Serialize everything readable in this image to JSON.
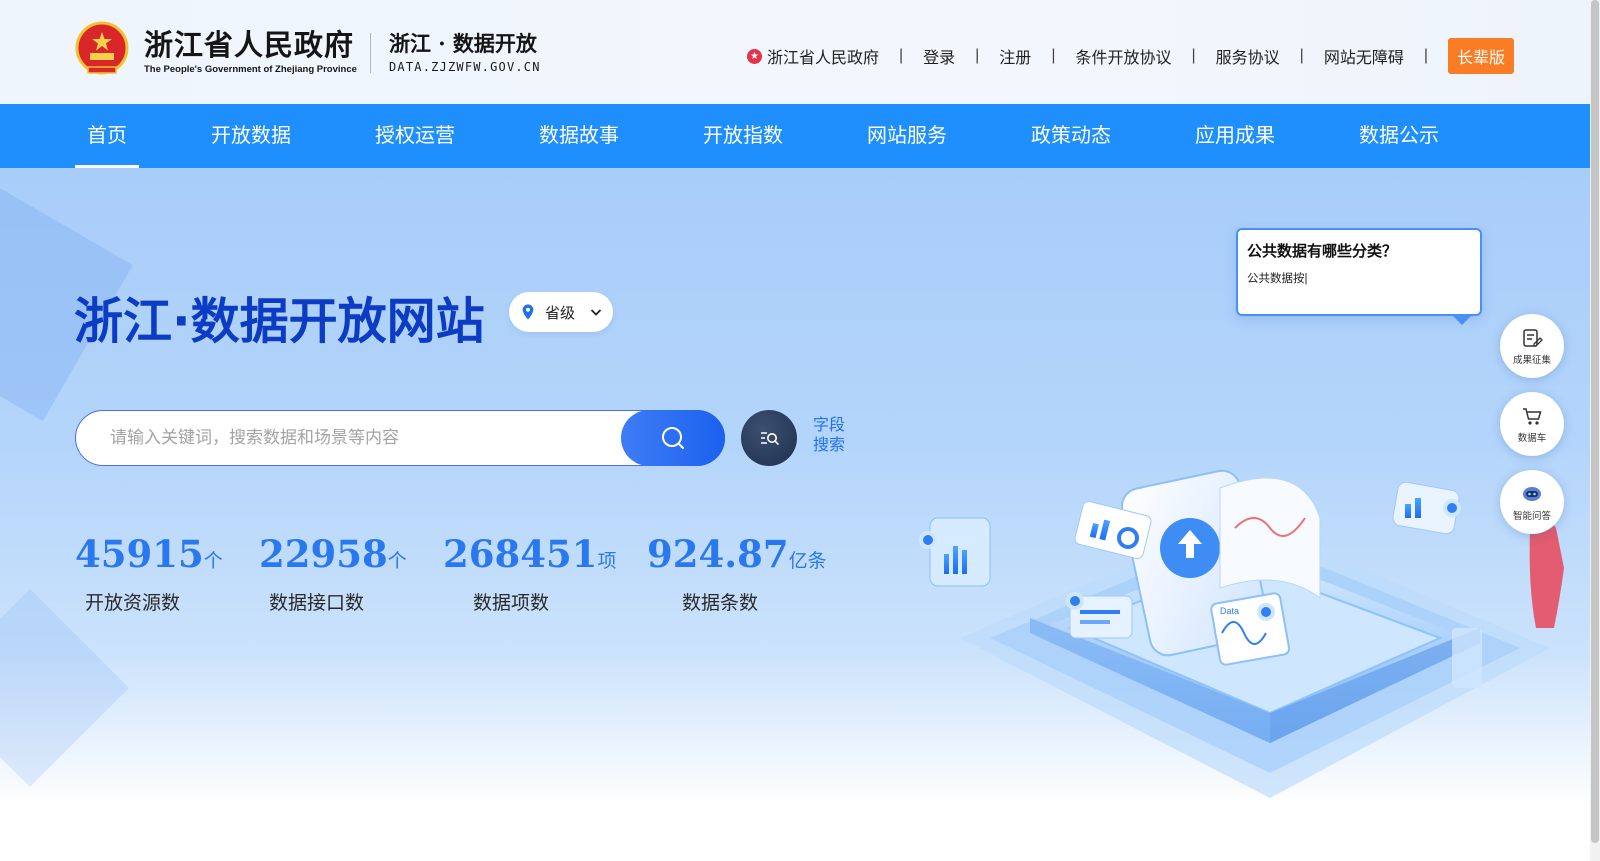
{
  "header": {
    "logo_cn": "浙江省人民政府",
    "logo_en": "The People's Government of Zhejiang Province",
    "site_cn": "浙江 · 数据开放",
    "site_url": "DATA.ZJZWFW.GOV.CN",
    "links": {
      "gov": "浙江省人民政府",
      "login": "登录",
      "register": "注册",
      "conditional_agreement": "条件开放协议",
      "service_agreement": "服务协议",
      "accessibility": "网站无障碍",
      "elder_mode": "长辈版"
    },
    "separator": "|"
  },
  "nav": {
    "items": [
      {
        "label": "首页",
        "active": true
      },
      {
        "label": "开放数据"
      },
      {
        "label": "授权运营"
      },
      {
        "label": "数据故事"
      },
      {
        "label": "开放指数"
      },
      {
        "label": "网站服务"
      },
      {
        "label": "政策动态"
      },
      {
        "label": "应用成果"
      },
      {
        "label": "数据公示"
      }
    ]
  },
  "hero": {
    "title": "浙江·数据开放网站",
    "level_select": {
      "value": "省级"
    },
    "search": {
      "placeholder": "请输入关键词，搜索数据和场景等内容",
      "value": ""
    },
    "field_search": {
      "line1": "字段",
      "line2": "搜索"
    },
    "stats": [
      {
        "value": "45915",
        "unit": "个",
        "label": "开放资源数"
      },
      {
        "value": "22958",
        "unit": "个",
        "label": "数据接口数"
      },
      {
        "value": "268451",
        "unit": "项",
        "label": "数据项数"
      },
      {
        "value": "924.87",
        "unit": "亿条",
        "label": "数据条数"
      }
    ],
    "bubble": {
      "question": "公共数据有哪些分类？",
      "answer": "公共数据按|"
    },
    "illustration_label": "Data"
  },
  "side_tools": [
    {
      "label": "成果征集",
      "icon": "edit-icon"
    },
    {
      "label": "数据车",
      "icon": "cart-icon"
    },
    {
      "label": "智能问答",
      "icon": "robot-icon"
    }
  ],
  "colors": {
    "nav_bg": "#1e8ffd",
    "title": "#0c3cc4",
    "stat": "#2a78ef",
    "elder_btn": "#fa7c25",
    "search_btn": "#1b61ef"
  }
}
